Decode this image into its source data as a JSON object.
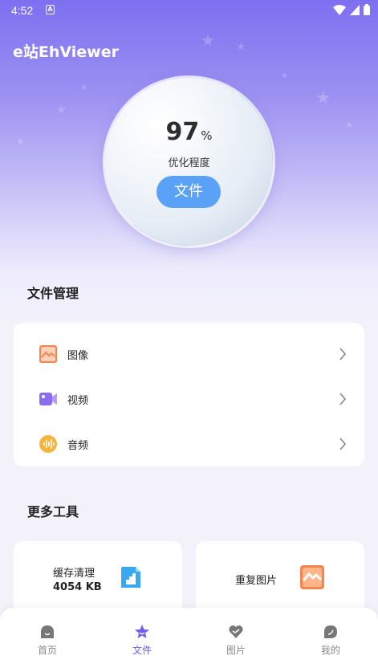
{
  "status_bar": {
    "time": "4:52",
    "notification_letter": "A"
  },
  "app": {
    "title": "e站EhViewer"
  },
  "optimization": {
    "percent": "97",
    "unit": "%",
    "label": "优化程度",
    "button": "文件"
  },
  "file_management": {
    "title": "文件管理",
    "items": [
      {
        "label": "图像",
        "icon": "image-icon",
        "color": "#f5854f"
      },
      {
        "label": "视频",
        "icon": "video-icon",
        "color": "#8c6cf0"
      },
      {
        "label": "音频",
        "icon": "audio-icon",
        "color": "#f7b43a"
      }
    ]
  },
  "more_tools": {
    "title": "更多工具",
    "cache": {
      "label": "缓存清理",
      "size": "4054 KB",
      "icon": "cache-icon"
    },
    "duplicate": {
      "label": "重复图片",
      "icon": "duplicate-image-icon"
    }
  },
  "bottom_nav": {
    "items": [
      {
        "label": "首页",
        "icon": "home-icon",
        "active": false
      },
      {
        "label": "文件",
        "icon": "file-icon",
        "active": true
      },
      {
        "label": "图片",
        "icon": "picture-icon",
        "active": false
      },
      {
        "label": "我的",
        "icon": "profile-icon",
        "active": false
      }
    ]
  },
  "colors": {
    "accent": "#6a5df0",
    "button_blue": "#5aa2f8",
    "header": "#7d6ff0"
  }
}
